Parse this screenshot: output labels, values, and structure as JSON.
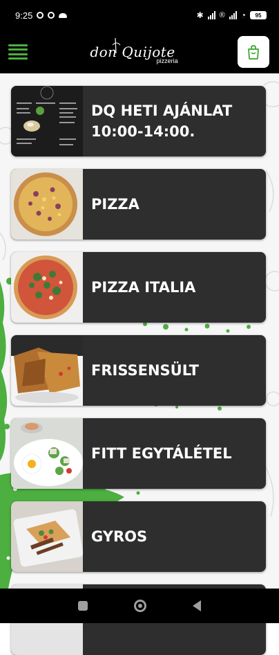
{
  "status_bar": {
    "time": "9:25",
    "battery": "95"
  },
  "header": {
    "logo_text": "don Quijote",
    "logo_sub": "pizzeria"
  },
  "categories": [
    {
      "label": "DQ HETI AJÁNLAT\n10:00-14:00."
    },
    {
      "label": "PIZZA"
    },
    {
      "label": "PIZZA ITALIA"
    },
    {
      "label": "FRISSENSÜLT"
    },
    {
      "label": "FITT EGYTÁLÉTEL"
    },
    {
      "label": "GYROS"
    },
    {
      "label": ""
    }
  ],
  "colors": {
    "accent_green": "#4caf3f",
    "card_bg": "#2e2e2e",
    "bar_bg": "#000000"
  }
}
